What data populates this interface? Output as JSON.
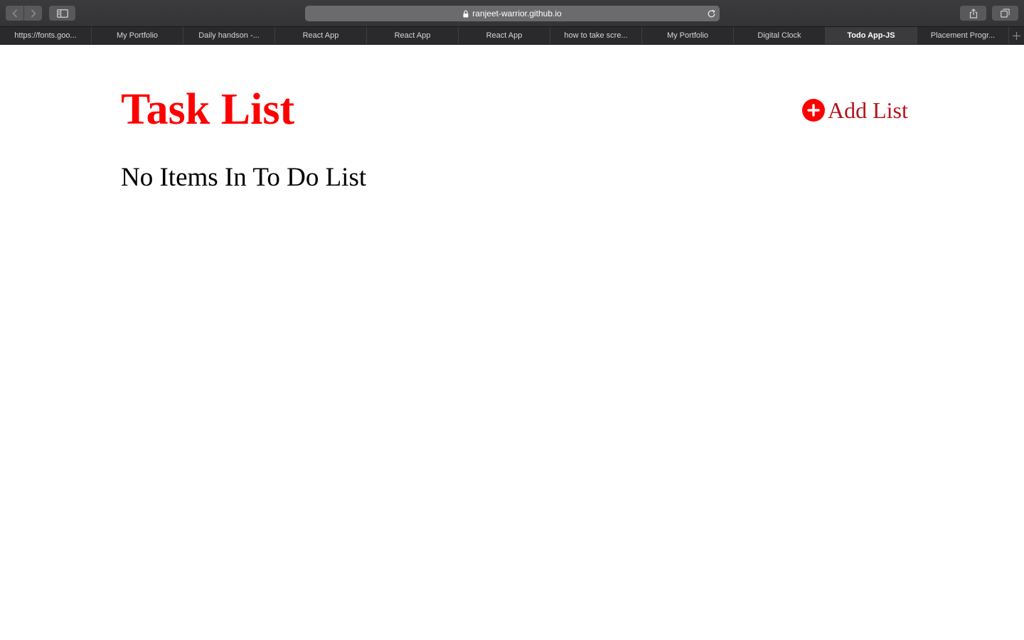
{
  "browser": {
    "url": "ranjeet-warrior.github.io",
    "tabs": [
      {
        "label": "https://fonts.goo...",
        "active": false
      },
      {
        "label": "My Portfolio",
        "active": false
      },
      {
        "label": "Daily handson -...",
        "active": false
      },
      {
        "label": "React App",
        "active": false
      },
      {
        "label": "React App",
        "active": false
      },
      {
        "label": "React App",
        "active": false
      },
      {
        "label": "how to take scre...",
        "active": false
      },
      {
        "label": "My Portfolio",
        "active": false
      },
      {
        "label": "Digital Clock",
        "active": false
      },
      {
        "label": "Todo App-JS",
        "active": true
      },
      {
        "label": "Placement Progr...",
        "active": false
      }
    ],
    "icons": {
      "back": "chevron-left-icon",
      "forward": "chevron-right-icon",
      "sidebar": "sidebar-icon",
      "lock": "lock-icon",
      "reload": "reload-icon",
      "share": "share-icon",
      "tabs": "tabs-overview-icon",
      "new_tab": "plus-icon"
    }
  },
  "app": {
    "title": "Task List",
    "add_button_label": "Add List",
    "empty_message": "No Items In To Do List",
    "colors": {
      "title": "#ff0000",
      "add_icon": "#ff0000",
      "add_label": "#b5121b"
    }
  }
}
